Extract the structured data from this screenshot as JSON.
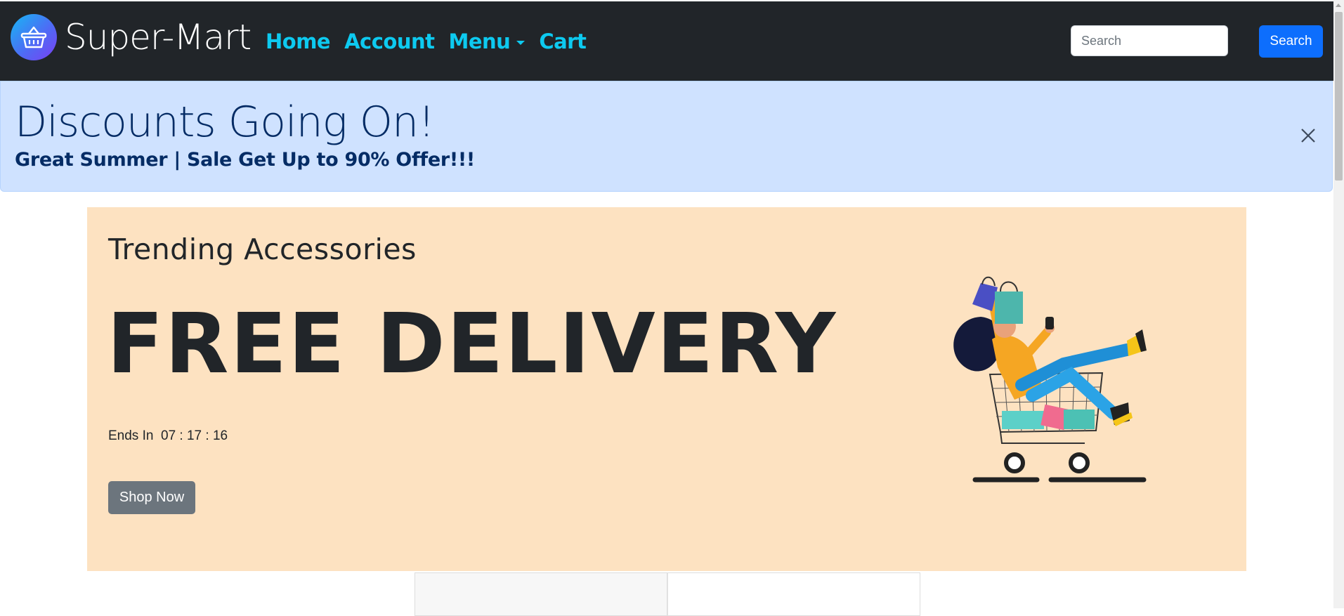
{
  "navbar": {
    "brand": "Super-Mart",
    "links": [
      {
        "label": "Home"
      },
      {
        "label": "Account"
      },
      {
        "label": "Menu"
      },
      {
        "label": "Cart"
      }
    ],
    "search": {
      "placeholder": "Search",
      "value": "",
      "button_label": "Search"
    }
  },
  "alert": {
    "heading": "Discounts Going On!",
    "text": "Great Summer | Sale Get Up to 90% Offer!!!"
  },
  "hero": {
    "subtitle": "Trending Accessories",
    "title": "FREE DELIVERY",
    "timer_label": "Ends In",
    "timer_value": "07 : 17 : 16",
    "button_label": "Shop Now"
  },
  "colors": {
    "navbar_bg": "#212529",
    "nav_link": "#0dcaf0",
    "alert_bg": "#cfe2ff",
    "alert_text": "#052c65",
    "hero_bg": "#fde2c1",
    "primary": "#0d6efd",
    "secondary": "#6c757d"
  },
  "icons": {
    "brand": "shopping-basket-icon",
    "dropdown": "caret-down-icon",
    "close": "close-icon",
    "hero": "shopping-cart-illustration"
  }
}
